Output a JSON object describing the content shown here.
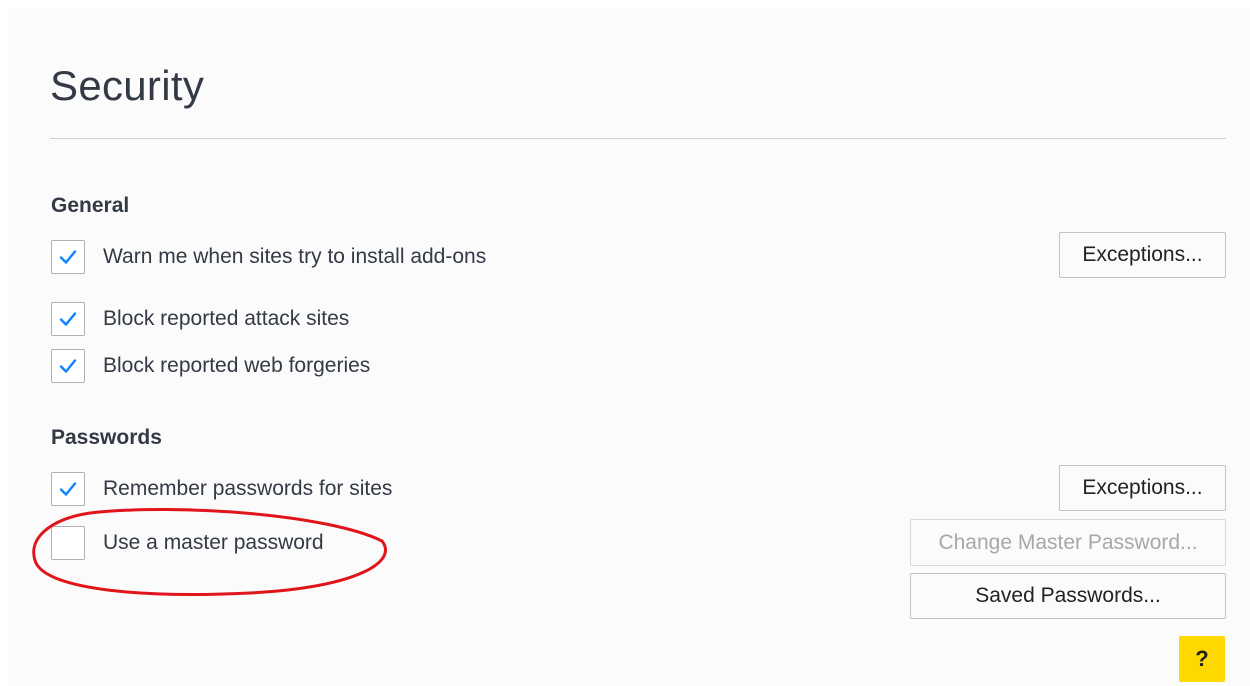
{
  "page": {
    "title": "Security"
  },
  "general": {
    "heading": "General",
    "items": [
      {
        "label": "Warn me when sites try to install add-ons",
        "checked": true
      },
      {
        "label": "Block reported attack sites",
        "checked": true
      },
      {
        "label": "Block reported web forgeries",
        "checked": true
      }
    ],
    "exceptions_label": "Exceptions..."
  },
  "passwords": {
    "heading": "Passwords",
    "items": [
      {
        "label": "Remember passwords for sites",
        "checked": true
      },
      {
        "label": "Use a master password",
        "checked": false
      }
    ],
    "exceptions_label": "Exceptions...",
    "change_master_label": "Change Master Password...",
    "change_master_enabled": false,
    "saved_passwords_label": "Saved Passwords..."
  },
  "help": {
    "label": "?"
  },
  "colors": {
    "checkmark": "#0a84ff",
    "help_button": "#ffd800",
    "annotation_ellipse": "#e0151b"
  },
  "icons": {
    "checkbox_checked": "checkmark-icon",
    "annotation": "red-ellipse-annotation"
  }
}
